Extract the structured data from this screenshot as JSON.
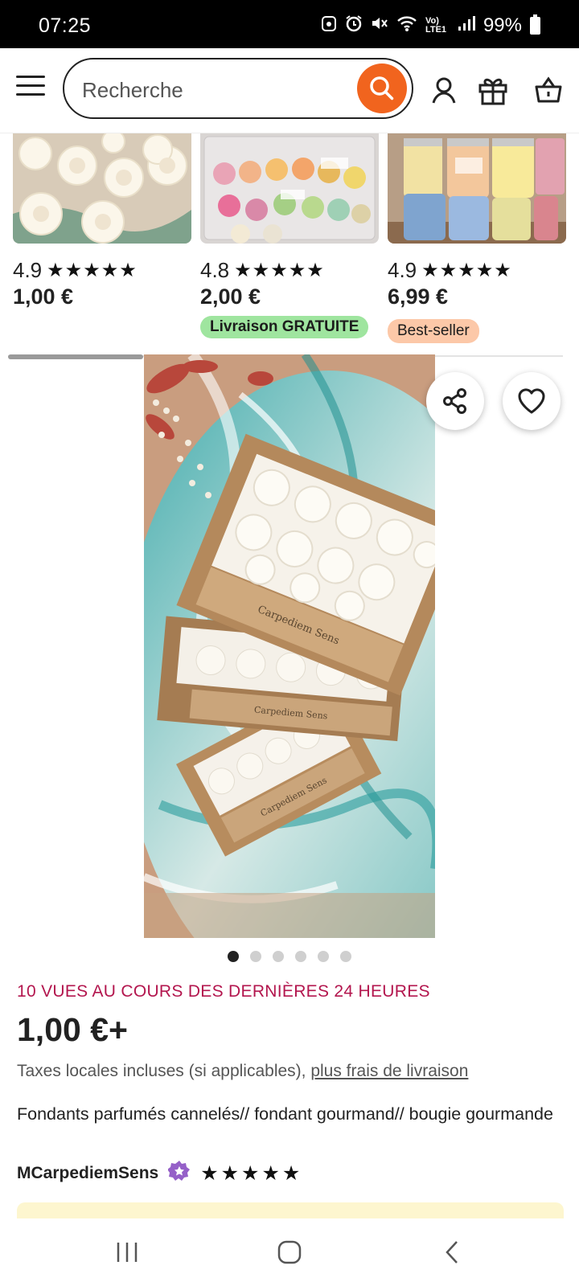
{
  "status_bar": {
    "time": "07:25",
    "network_label": "Vo) LTE1",
    "battery_pct": "99%"
  },
  "header": {
    "search_placeholder": "Recherche",
    "accent_color": "#f1641e"
  },
  "related_products": [
    {
      "rating": "4.9",
      "stars": "★★★★★",
      "price": "1,00 €",
      "badge": ""
    },
    {
      "rating": "4.8",
      "stars": "★★★★★",
      "price": "2,00 €",
      "badge": "Livraison GRATUITE"
    },
    {
      "rating": "4.9",
      "stars": "★★★★★",
      "price": "6,99 €",
      "badge": "Best-seller"
    }
  ],
  "product": {
    "views": "10 VUES AU COURS DES DERNIÈRES 24 HEURES",
    "price": "1,00 €+",
    "taxes_text": "Taxes locales incluses (si applicables), ",
    "shipping_link": "plus frais de livraison",
    "title": "Fondants parfumés cannelés// fondant gourmand// bougie gourmande",
    "shop_name": "MCarpediemSens",
    "shop_stars": "★★★★★",
    "box_label": "Carpediem Sens",
    "image_count": 6,
    "active_image": 1
  }
}
